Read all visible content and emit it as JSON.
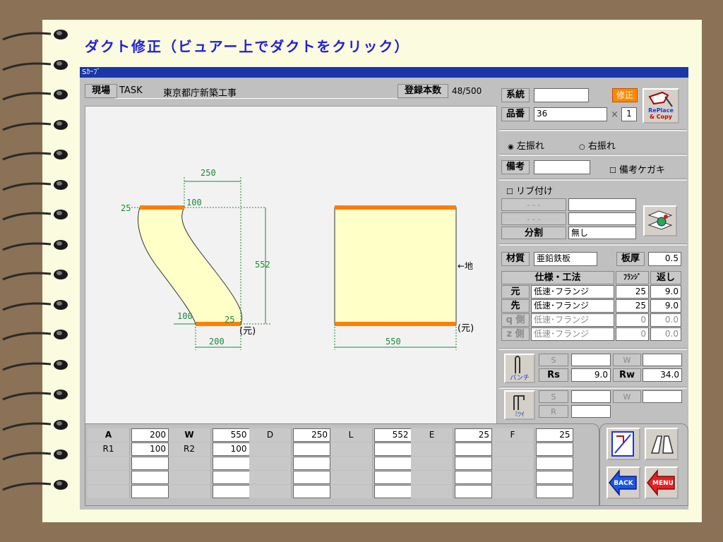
{
  "heading": "ダクト修正（ビュアー上でダクトをクリック）",
  "window": {
    "title": "Sｶｰﾌﾞ"
  },
  "header": {
    "site_label": "現場",
    "site_code": "TASK",
    "site_name": "東京都庁新築工事",
    "count_label": "登録本数",
    "count_value": "48/500"
  },
  "right": {
    "system_label": "系統",
    "system_value": "",
    "fix_button": "修正",
    "part_label": "品番",
    "part_value": "36",
    "times": "×",
    "qty": "1",
    "replace_button": "RePlace\n& Copy",
    "left_swing": "左振れ",
    "right_swing": "右振れ",
    "remark_label": "備考",
    "remark_value": "",
    "remark_mark": "備考ケガキ",
    "rib": "リブ付け",
    "dash1": "- - -",
    "dash2": "- - -",
    "split_label": "分割",
    "split_value": "無し",
    "material_label": "材質",
    "material_value": "亜鉛鉄板",
    "thickness_label": "板厚",
    "thickness_value": "0.5",
    "spec_header": "仕様・工法",
    "flange_header": "ﾌﾗﾝｼﾞ",
    "return_header": "返し",
    "spec_rows": [
      {
        "label": "元",
        "spec": "低速･フランジ",
        "flange": "25",
        "ret": "9.0",
        "enabled": true
      },
      {
        "label": "先",
        "spec": "低速･フランジ",
        "flange": "25",
        "ret": "9.0",
        "enabled": true
      },
      {
        "label": "q 側",
        "spec": "低速･フランジ",
        "flange": "0",
        "ret": "0.0",
        "enabled": false
      },
      {
        "label": "z 側",
        "spec": "低速･フランジ",
        "flange": "0",
        "ret": "0.0",
        "enabled": false
      }
    ],
    "punch_label": "パンチ",
    "s_label": "S",
    "w_label": "W",
    "rs_label": "Rs",
    "rs_value": "9.0",
    "rw_label": "Rw",
    "rw_value": "34.0",
    "mitsui_label": "ﾐﾂｲ",
    "r_label": "R"
  },
  "drawing": {
    "dim_top": "250",
    "dim_100a": "100",
    "dim_25a": "25",
    "dim_552": "552",
    "dim_100b": "100",
    "dim_25b": "25",
    "dim_200": "200",
    "moto1": "(元)",
    "dim_550": "550",
    "ground": "←地",
    "moto2": "(元)"
  },
  "params": {
    "row1": [
      [
        "A",
        "200"
      ],
      [
        "W",
        "550"
      ],
      [
        "D",
        "250"
      ],
      [
        "L",
        "552"
      ],
      [
        "E",
        "25"
      ],
      [
        "F",
        "25"
      ]
    ],
    "row2": [
      [
        "R1",
        "100"
      ],
      [
        "R2",
        "100"
      ],
      [
        "",
        ""
      ],
      [
        "",
        ""
      ],
      [
        "",
        ""
      ],
      [
        "",
        ""
      ]
    ],
    "row3": [
      [
        "",
        ""
      ],
      [
        "",
        ""
      ],
      [
        "",
        ""
      ],
      [
        "",
        ""
      ],
      [
        "",
        ""
      ],
      [
        "",
        ""
      ]
    ],
    "row4": [
      [
        "",
        ""
      ],
      [
        "",
        ""
      ],
      [
        "",
        ""
      ],
      [
        "",
        ""
      ],
      [
        "",
        ""
      ],
      [
        "",
        ""
      ]
    ],
    "row5": [
      [
        "",
        ""
      ],
      [
        "",
        ""
      ],
      [
        "",
        ""
      ],
      [
        "",
        ""
      ],
      [
        "",
        ""
      ],
      [
        "",
        ""
      ]
    ]
  },
  "buttons": {
    "back": "BACK",
    "menu": "MENU"
  }
}
